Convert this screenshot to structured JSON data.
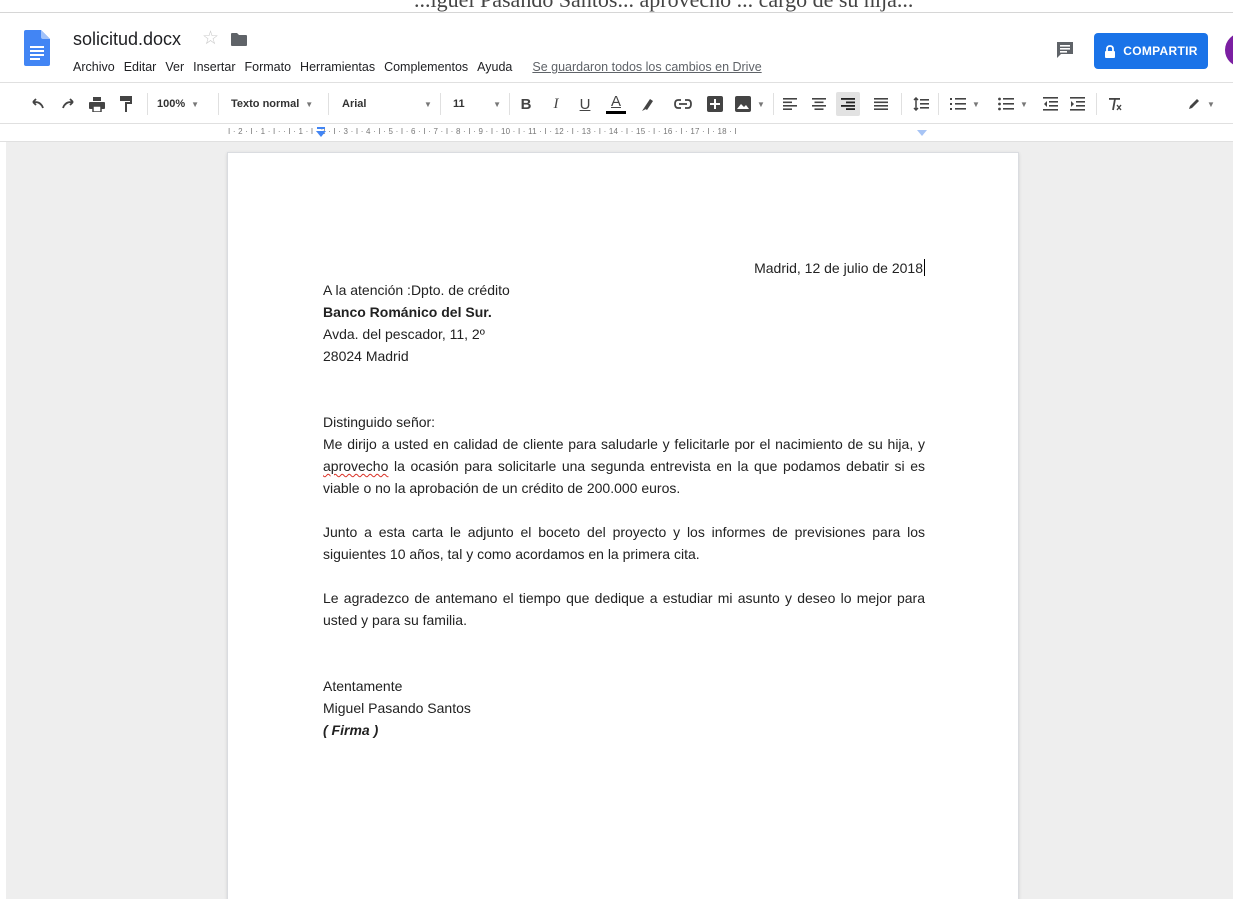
{
  "page_top": {
    "cropped_text": "...iguel Pasando Santos... aprovecho ... cargo de su hija..."
  },
  "document": {
    "title": "solicitud.docx",
    "saved_status": "Se guardaron todos los cambios en Drive"
  },
  "menu": {
    "items": [
      "Archivo",
      "Editar",
      "Ver",
      "Insertar",
      "Formato",
      "Herramientas",
      "Complementos",
      "Ayuda"
    ]
  },
  "share": {
    "label": "COMPARTIR",
    "color": "#1a73e8"
  },
  "avatar": {
    "color": "#7b1fa2"
  },
  "toolbar": {
    "zoom": "100%",
    "style": "Texto normal",
    "font": "Arial",
    "font_size": "11",
    "bold_label": "B",
    "italic_label": "I",
    "underline_label": "U",
    "text_color_label": "A",
    "active_alignment": "right",
    "icons": [
      "undo-icon",
      "redo-icon",
      "print-icon",
      "paint-format-icon",
      "highlight-icon",
      "link-icon",
      "add-comment-icon",
      "image-icon",
      "align-left-icon",
      "align-center-icon",
      "align-right-icon",
      "align-justify-icon",
      "line-spacing-icon",
      "numbered-list-icon",
      "bulleted-list-icon",
      "decrease-indent-icon",
      "increase-indent-icon",
      "clear-formatting-icon",
      "editing-mode-icon"
    ]
  },
  "ruler": {
    "marks": "I · 2 · I · 1 · I ·    · I · 1 · I · 2 · I · 3 · I · 4 · I · 5 · I · 6 · I · 7 · I · 8 · I · 9 · I · 10 · I · 11 · I · 12 · I · 13 · I · 14 · I · 15 · I · 16 · I · 17 · I · 18 · I"
  },
  "letter": {
    "date": "Madrid, 12 de julio de 2018",
    "attention": "A la atención :Dpto. de crédito",
    "bank": "Banco Románico del Sur.",
    "address1": "Avda. del pescador, 11, 2º",
    "address2": "28024 Madrid",
    "salutation": "Distinguido señor:",
    "p1_start": "Me dirijo a usted en calidad de cliente para saludarle y felicitarle por el nacimiento de su hija, y ",
    "p1_flagged": "aprovecho",
    "p1_end": " la ocasión para solicitarle una segunda entrevista en la que podamos debatir si es viable o no la aprobación de un crédito de 200.000 euros.",
    "p2": "Junto a esta carta le adjunto el boceto del proyecto y los informes de previsiones para los siguientes 10 años, tal y como acordamos en la primera cita.",
    "p3": "Le agradezco de antemano el tiempo que dedique a estudiar mi asunto y deseo lo mejor para usted y para su familia.",
    "closing": "Atentamente",
    "signer": "Miguel Pasando Santos",
    "signature": "( Firma )"
  }
}
